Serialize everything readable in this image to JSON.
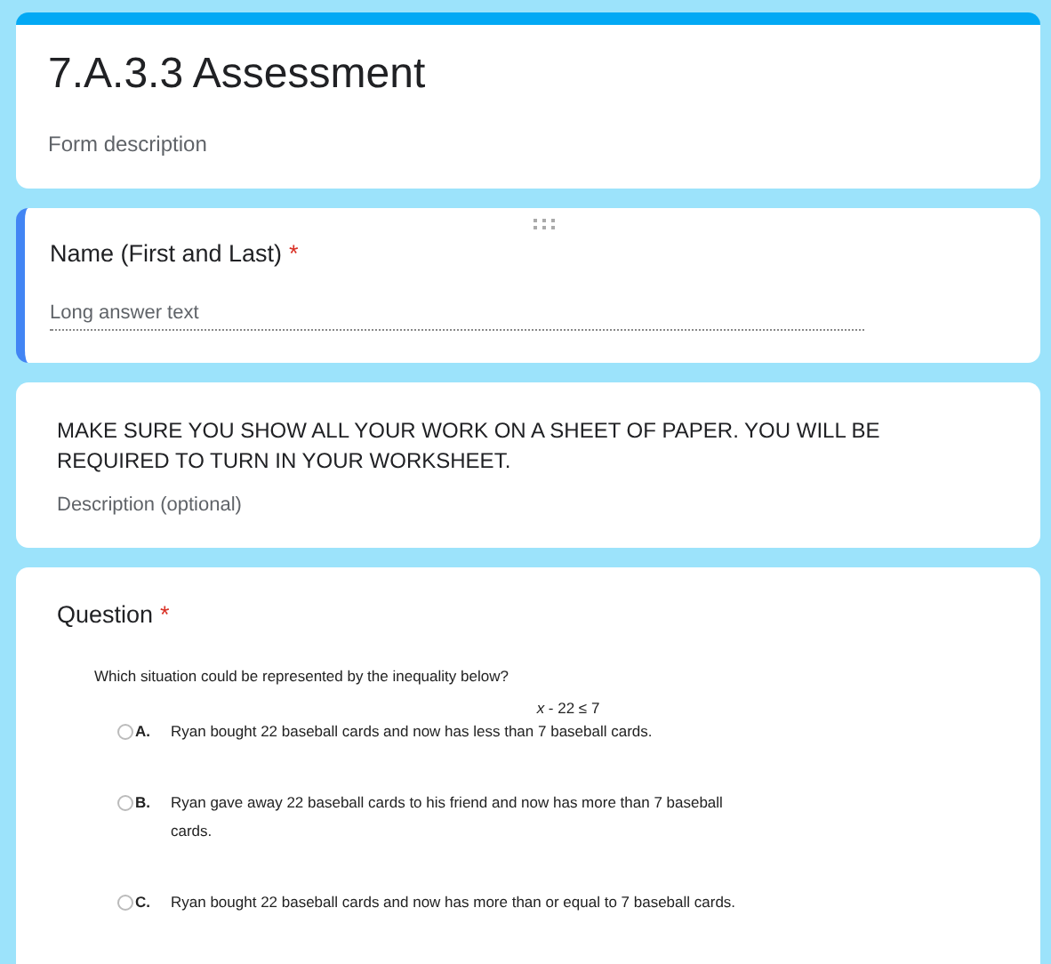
{
  "header": {
    "title": "7.A.3.3 Assessment",
    "description": "Form description"
  },
  "items": [
    {
      "kind": "text_question",
      "selected": true,
      "title": "Name (First and Last)",
      "required_mark": "*",
      "placeholder": "Long answer text"
    },
    {
      "kind": "section_text",
      "selected": false,
      "title": "MAKE SURE YOU SHOW ALL YOUR WORK ON A SHEET OF PAPER. YOU WILL BE REQUIRED TO TURN IN YOUR WORKSHEET.",
      "placeholder": "Description (optional)"
    },
    {
      "kind": "choice_question",
      "selected": false,
      "title": "Question",
      "required_mark": "*",
      "prompt": "Which situation could be represented by the inequality below?",
      "formula": "*x* - 22 ≤ 7",
      "options": [
        {
          "letter": "A.",
          "text": "Ryan bought 22 baseball cards and now has less than 7 baseball cards.",
          "selected": false
        },
        {
          "letter": "B.",
          "text": "Ryan gave away 22 baseball cards to his friend and now has more than 7 baseball cards.",
          "selected": false
        },
        {
          "letter": "C.",
          "text": "Ryan bought 22 baseball cards and now has more than or equal to 7 baseball cards.",
          "selected": false
        }
      ]
    }
  ]
}
